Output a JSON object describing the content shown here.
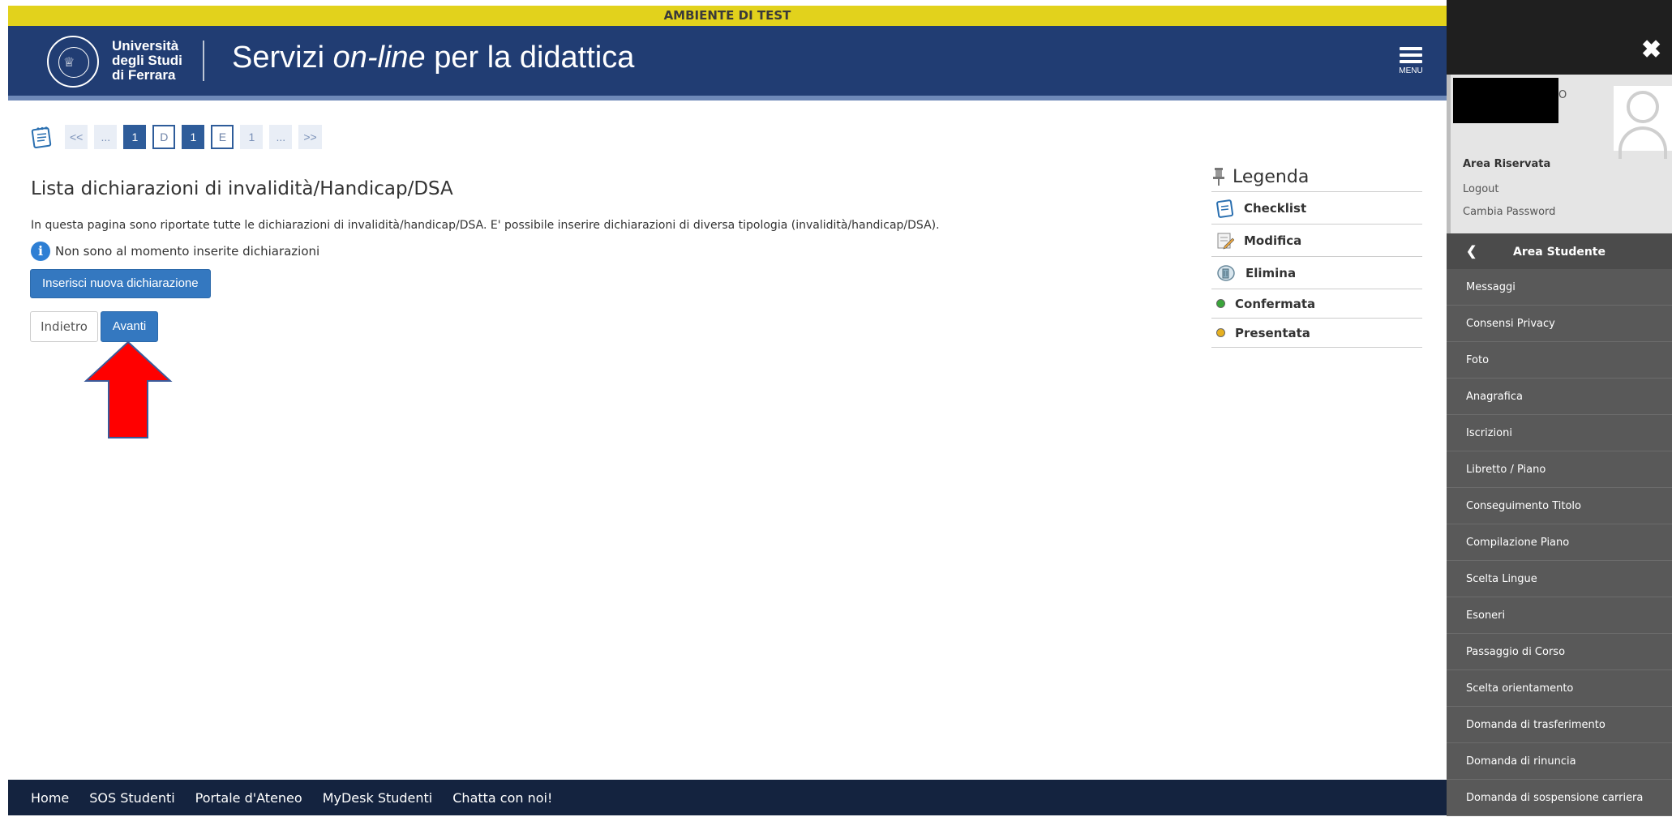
{
  "banner": {
    "text": "AMBIENTE DI TEST"
  },
  "header": {
    "logo_line1": "Università",
    "logo_line2": "degli Studi",
    "logo_line3": "di Ferrara",
    "title_prefix": "Servizi ",
    "title_italic": "on-line",
    "title_suffix": " per la didattica",
    "menu_label": "MENU",
    "brand_color": "#213d73"
  },
  "steps": [
    "<<",
    "...",
    "1",
    "D",
    "1",
    "E",
    "1",
    "...",
    ">>"
  ],
  "main": {
    "title": "Lista dichiarazioni di invalidità/Handicap/DSA",
    "description": "In questa pagina sono riportate tutte le dichiarazioni di invalidità/handicap/DSA. E' possibile inserire dichiarazioni di diversa tipologia (invalidità/handicap/DSA).",
    "info_message": "Non sono al momento inserite dichiarazioni",
    "insert_button": "Inserisci nuova dichiarazione",
    "back_button": "Indietro",
    "next_button": "Avanti"
  },
  "legend": {
    "title": "Legenda",
    "items": [
      {
        "label": "Checklist",
        "icon": "checklist-icon"
      },
      {
        "label": "Modifica",
        "icon": "edit-icon"
      },
      {
        "label": "Elimina",
        "icon": "delete-icon"
      },
      {
        "label": "Confermata",
        "icon": "green-dot-icon",
        "color": "#3aa53a"
      },
      {
        "label": "Presentata",
        "icon": "yellow-dot-icon",
        "color": "#e6b020"
      }
    ]
  },
  "footer": {
    "links": [
      "Home",
      "SOS Studenti",
      "Portale d'Ateneo",
      "MyDesk Studenti",
      "Chatta con noi!"
    ]
  },
  "side": {
    "user_suffix": "O",
    "area_title": "Area Riservata",
    "logout": "Logout",
    "change_password": "Cambia Password",
    "nav_title": "Area Studente",
    "items": [
      "Messaggi",
      "Consensi Privacy",
      "Foto",
      "Anagrafica",
      "Iscrizioni",
      "Libretto / Piano",
      "Conseguimento Titolo",
      "Compilazione Piano",
      "Scelta Lingue",
      "Esoneri",
      "Passaggio di Corso",
      "Scelta orientamento",
      "Domanda di trasferimento",
      "Domanda di rinuncia",
      "Domanda di sospensione carriera"
    ]
  }
}
